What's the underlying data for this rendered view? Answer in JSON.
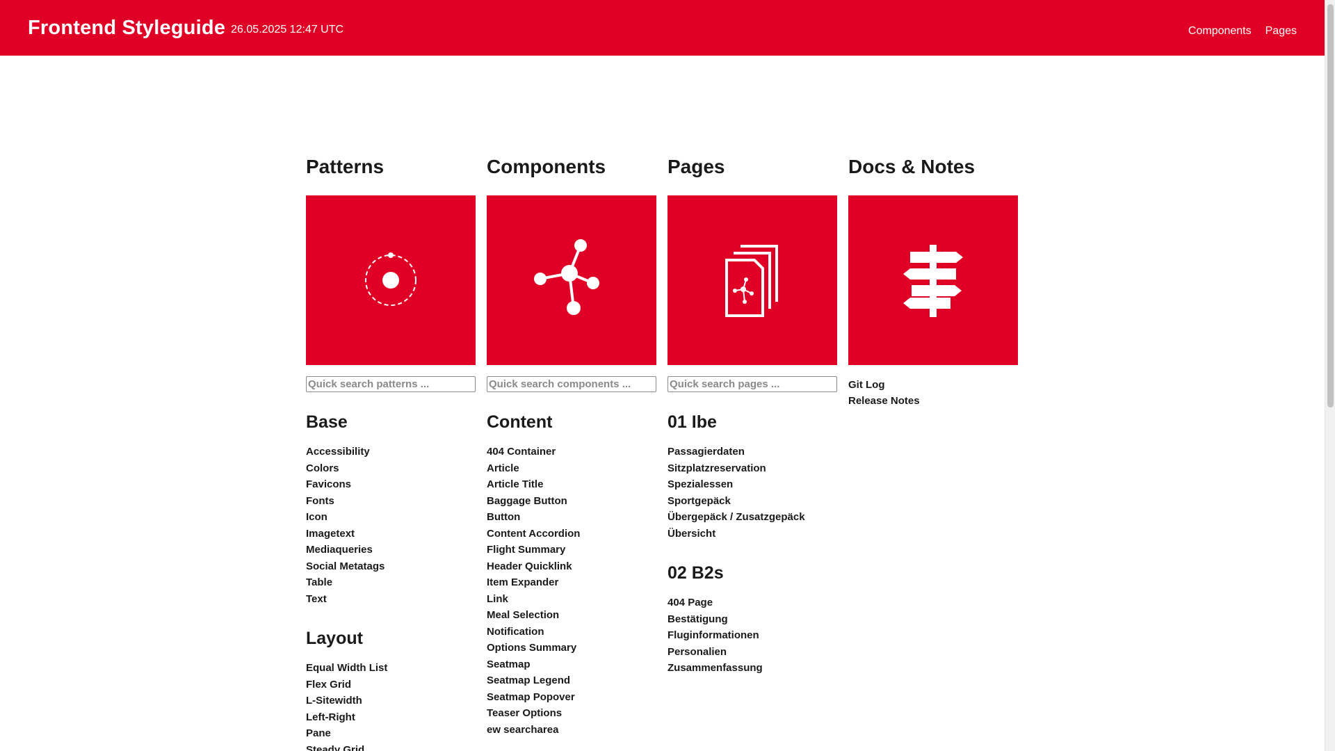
{
  "header": {
    "brand": "Frontend Styleguide",
    "timestamp": "26.05.2025 12:47 UTC",
    "nav": [
      "Components",
      "Pages"
    ]
  },
  "colors": {
    "accent": "#e10025",
    "text": "#1a1a1a"
  },
  "columns": {
    "patterns": {
      "title": "Patterns",
      "icon": "atom-orbit-icon",
      "search_placeholder": "Quick search patterns ...",
      "sections": [
        {
          "title": "Base",
          "items": [
            "Accessibility",
            "Colors",
            "Favicons",
            "Fonts",
            "Icon",
            "Imagetext",
            "Mediaqueries",
            "Social Metatags",
            "Table",
            "Text"
          ]
        },
        {
          "title": "Layout",
          "items": [
            "Equal Width List",
            "Flex Grid",
            "L-Sitewidth",
            "Left-Right",
            "Pane",
            "Steady Grid"
          ]
        }
      ]
    },
    "components": {
      "title": "Components",
      "icon": "molecule-icon",
      "search_placeholder": "Quick search components ...",
      "sections": [
        {
          "title": "Content",
          "items": [
            "404 Container",
            "Article",
            "Article Title",
            "Baggage Button",
            "Button",
            "Content Accordion",
            "Flight Summary",
            "Header Quicklink",
            "Item Expander",
            "Link",
            "Meal Selection",
            "Notification",
            "Options Summary",
            "Seatmap",
            "Seatmap Legend",
            "Seatmap Popover",
            "Teaser Options",
            "ew searcharea"
          ]
        }
      ]
    },
    "pages": {
      "title": "Pages",
      "icon": "documents-icon",
      "search_placeholder": "Quick search pages ...",
      "sections": [
        {
          "title": "01 Ibe",
          "items": [
            "Passagierdaten",
            "Sitzplatzreservation",
            "Spezialessen",
            "Sportgepäck",
            "Übergepäck / Zusatzgepäck",
            "Übersicht"
          ]
        },
        {
          "title": "02 B2s",
          "items": [
            "404 Page",
            "Bestätigung",
            "Fluginformationen",
            "Personalien",
            "Zusammenfassung"
          ]
        }
      ]
    },
    "docs": {
      "title": "Docs & Notes",
      "icon": "signpost-icon",
      "links": [
        "Git Log",
        "Release Notes"
      ]
    }
  }
}
